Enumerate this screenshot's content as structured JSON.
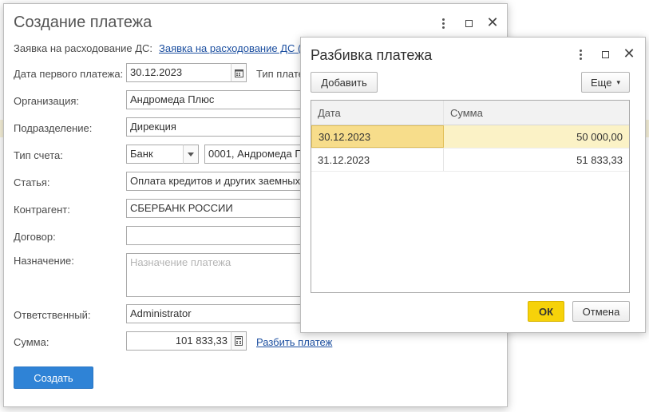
{
  "main": {
    "title": "Создание платежа",
    "request_label": "Заявка на расходование ДС:",
    "request_link": "Заявка на расходование ДС (",
    "first_payment_date_label": "Дата первого платежа:",
    "first_payment_date": "30.12.2023",
    "payment_type_label": "Тип плате",
    "organization_label": "Организация:",
    "organization": "Андромеда Плюс",
    "department_label": "Подразделение:",
    "department": "Дирекция",
    "account_type_label": "Тип счета:",
    "account_type": "Банк",
    "account": "0001, Андромеда П",
    "article_label": "Статья:",
    "article": "Оплата кредитов и других заемных",
    "counterparty_label": "Контрагент:",
    "counterparty": "СБЕРБАНК РОССИИ",
    "contract_label": "Договор:",
    "contract": "",
    "purpose_label": "Назначение:",
    "purpose_placeholder": "Назначение платежа",
    "responsible_label": "Ответственный:",
    "responsible": "Administrator",
    "amount_label": "Сумма:",
    "amount": "101 833,33",
    "split_link": "Разбить платеж",
    "create_button": "Создать"
  },
  "dialog": {
    "title": "Разбивка платежа",
    "add_button": "Добавить",
    "more_button": "Еще",
    "columns": [
      "Дата",
      "Сумма"
    ],
    "rows": [
      {
        "date": "30.12.2023",
        "amount": "50 000,00"
      },
      {
        "date": "31.12.2023",
        "amount": "51 833,33"
      }
    ],
    "ok_button": "ОК",
    "cancel_button": "Отмена"
  },
  "icons": [
    "more-vertical-icon",
    "maximize-icon",
    "close-icon",
    "calendar-icon",
    "dropdown-arrow-icon",
    "calculator-icon",
    "chevron-down-icon"
  ]
}
